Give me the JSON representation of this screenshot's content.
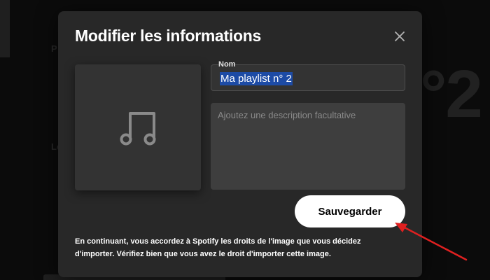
{
  "background": {
    "left_snippet": "P",
    "left_snippet_2": "Le",
    "right_title_fragment": "°2"
  },
  "modal": {
    "title": "Modifier les informations",
    "close_icon": "close-icon",
    "image_placeholder_icon": "music-note-icon",
    "name_field": {
      "label": "Nom",
      "value": "Ma playlist n° 2",
      "selected": true
    },
    "description_field": {
      "placeholder": "Ajoutez une description facultative",
      "value": ""
    },
    "save_label": "Sauvegarder",
    "disclaimer": "En continuant, vous accordez à Spotify les droits de l'image que vous décidez d'importer. Vérifiez bien que vous avez le droit d'importer cette image."
  },
  "annotation": {
    "arrow_color": "#e02020",
    "arrow_target": "save-button"
  },
  "colors": {
    "modal_bg": "#282828",
    "field_bg": "#333333",
    "selection": "#1d4ba5",
    "button_bg": "#ffffff"
  }
}
